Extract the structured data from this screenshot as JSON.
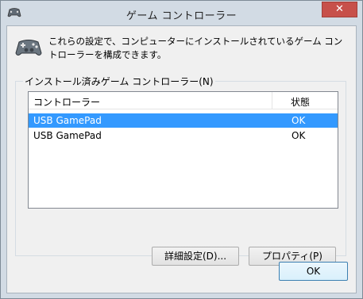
{
  "window": {
    "title": "ゲーム コントローラー",
    "close_label": "✕"
  },
  "description": "これらの設定で、コンピューターにインストールされているゲーム コントローラーを構成できます。",
  "group": {
    "label": "インストール済みゲーム コントローラー(N)"
  },
  "list": {
    "headers": {
      "name": "コントローラー",
      "status": "状態"
    },
    "rows": [
      {
        "name": "USB GamePad",
        "status": "OK",
        "selected": true
      },
      {
        "name": "USB GamePad",
        "status": "OK",
        "selected": false
      }
    ]
  },
  "buttons": {
    "advanced": "詳細設定(D)...",
    "properties": "プロパティ(P)",
    "ok": "OK"
  },
  "icons": {
    "title": "gamepad-icon",
    "main": "gamepad-icon"
  },
  "colors": {
    "selection": "#3399ff",
    "close": "#c7504a",
    "frame": "#d2dbe4"
  }
}
